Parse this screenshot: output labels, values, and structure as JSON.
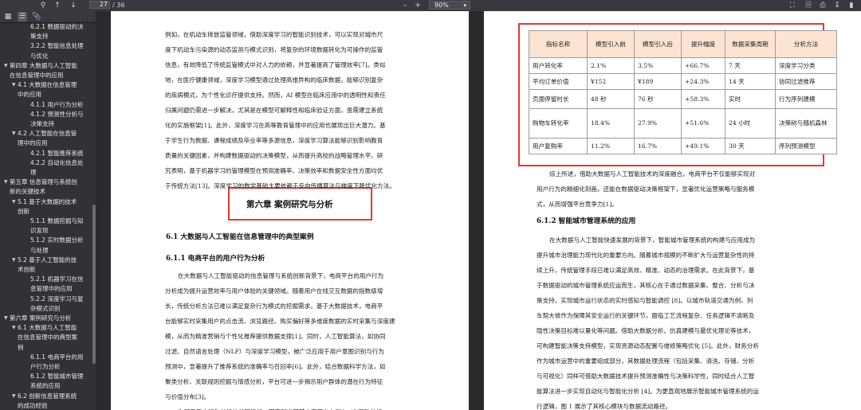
{
  "toolbar": {
    "page_current": "27",
    "page_total": "/ 36",
    "zoom": "90%"
  },
  "sidebar": {
    "items": [
      {
        "label": "6.2.1 数据驱动的决",
        "indent": 3,
        "twisty": ""
      },
      {
        "label": "策支持",
        "indent": 3,
        "twisty": ""
      },
      {
        "label": "3.2.2 智能信息处理",
        "indent": 3,
        "twisty": ""
      },
      {
        "label": "与优化",
        "indent": 3,
        "twisty": ""
      },
      {
        "label": "第四章 大数据与人工智能",
        "indent": 1,
        "twisty": "▼"
      },
      {
        "label": "在信息管理中的应用",
        "indent": 1,
        "twisty": ""
      },
      {
        "label": "4.1 大数据在信息管理",
        "indent": 2,
        "twisty": "▼"
      },
      {
        "label": "中的应用",
        "indent": 2,
        "twisty": ""
      },
      {
        "label": "4.1.1 用户行为分析",
        "indent": 3,
        "twisty": ""
      },
      {
        "label": "4.1.2 预测性分析与",
        "indent": 3,
        "twisty": ""
      },
      {
        "label": "决策支持",
        "indent": 3,
        "twisty": ""
      },
      {
        "label": "4.2 人工智能在信息管",
        "indent": 2,
        "twisty": "▼"
      },
      {
        "label": "理中的应用",
        "indent": 2,
        "twisty": ""
      },
      {
        "label": "4.2.1 智能推荐系统",
        "indent": 3,
        "twisty": ""
      },
      {
        "label": "4.2.2 自动化信息处",
        "indent": 3,
        "twisty": ""
      },
      {
        "label": "理",
        "indent": 3,
        "twisty": ""
      },
      {
        "label": "第五章 信息管理与系统创",
        "indent": 1,
        "twisty": "▼"
      },
      {
        "label": "新的关键技术",
        "indent": 1,
        "twisty": ""
      },
      {
        "label": "5.1 基于大数据的技术",
        "indent": 2,
        "twisty": "▼"
      },
      {
        "label": "创新",
        "indent": 2,
        "twisty": ""
      },
      {
        "label": "5.1.1 数据挖掘与知",
        "indent": 3,
        "twisty": ""
      },
      {
        "label": "识发现",
        "indent": 3,
        "twisty": ""
      },
      {
        "label": "5.1.2 实时数据分析",
        "indent": 3,
        "twisty": ""
      },
      {
        "label": "与处理",
        "indent": 3,
        "twisty": ""
      },
      {
        "label": "5.2 基于人工智能的技",
        "indent": 2,
        "twisty": "▼"
      },
      {
        "label": "术创新",
        "indent": 2,
        "twisty": ""
      },
      {
        "label": "5.2.1 机器学习在信",
        "indent": 3,
        "twisty": ""
      },
      {
        "label": "息管理中的应用",
        "indent": 3,
        "twisty": ""
      },
      {
        "label": "5.2.2 深度学习与复",
        "indent": 3,
        "twisty": ""
      },
      {
        "label": "杂模式识别",
        "indent": 3,
        "twisty": ""
      },
      {
        "label": "第六章 案例研究与分析",
        "indent": 1,
        "twisty": "▼"
      },
      {
        "label": "6.1 大数据与人工智能",
        "indent": 2,
        "twisty": "▼"
      },
      {
        "label": "在信息管理中的典型案",
        "indent": 2,
        "twisty": ""
      },
      {
        "label": "例",
        "indent": 2,
        "twisty": ""
      },
      {
        "label": "6.1.1 电商平台的用",
        "indent": 3,
        "twisty": ""
      },
      {
        "label": "户行为分析",
        "indent": 3,
        "twisty": ""
      },
      {
        "label": "6.1.2 智能城市管理",
        "indent": 3,
        "twisty": ""
      },
      {
        "label": "系统的应用",
        "indent": 3,
        "twisty": ""
      },
      {
        "label": "6.2 创新信息管理系统",
        "indent": 2,
        "twisty": "▼"
      },
      {
        "label": "的成功经验",
        "indent": 2,
        "twisty": ""
      }
    ]
  },
  "left_page": {
    "top_lines": [
      "例如，在机动车排放监管领域，借助深度学习的智能识别技术，可以实现对城市尺",
      "度下机动车污染源的动态监测与模式识别，将复杂的环境数据转化为可操作的监管",
      "信息，有效降低了传统监管模式中对人力的依赖，并显著提高了管理效率[7]。类似",
      "地，在医疗健康领域，深度学习模型通过处理高维异构的临床数据，能够识别复杂",
      "的疾病模式，为个性化诊疗提供支持。然而，AI 模型在临床应用中的透明性和责任",
      "归属问题仍需进一步解决，尤其是在模型可解释性和临床验证方面，亟需建立系统",
      "化的实施框架[1]。此外，深度学习在高等教育管理中的应用也展现出巨大潜力。基",
      "于学生行为数据、课程成绩及毕业率等多源信息，深度学习算法能够识别影响教育",
      "质量的关键因素，并构建数据驱动的决策模型，从而提升高校的战略管理水平。研",
      "究表明，基于机器学习的管理模型在预测准确率、决策效率和数据安全性方面均优",
      "于传统方法[13]。深度学习的数学基础主要依赖于反向传播算法与梯度下降优化方法。"
    ],
    "chapter_title": "第六章  案例研究与分析",
    "section_6_1": "6.1  大数据与人工智能在信息管理中的典型案例",
    "section_6_1_1": "6.1.1  电商平台的用户行为分析",
    "bottom_lines": [
      "在大数据与人工智能驱动的信息管理与系统创新背景下，电商平台的用户行为",
      "分析成为提升运营效率与用户体验的关键领域。随着用户在线交互数据的指数级增",
      "长，传统分析方法已难以满足复杂行为模式的挖掘需求。基于大数据技术，电商平",
      "台能够实时采集用户的点击流、浏览路径、购买偏好等多维度数据的实时采集与深度建",
      "模，从而为精准营销与个性化推荐提供数据支撑[1]。同时，人工智能算法，如协同",
      "过滤、自然语言处理（NLP）与深度学习模型，被广泛应用于用户意图识别与行为",
      "预测中，显著提升了推荐系统的准确率与召回率[6]。此外，结合数据科学方法，如",
      "聚类分析、关联规则挖掘与情感分析，平台可进一步揭示用户群体的潜在行为特征",
      "与价值分布[3]。",
      "为展示用户行为分析的关键指标，下表列出了某电商平台在引入 AI 驱动分析"
    ]
  },
  "right_page": {
    "table": {
      "headers": [
        "指标名称",
        "模型引入前",
        "模型引入后",
        "提升幅度",
        "数据采集周期",
        "分析方法"
      ],
      "rows": [
        [
          "用户转化率",
          "2.1%",
          "3.5%",
          "+66.7%",
          "7 天",
          "深度学习分类"
        ],
        [
          "平均订单价值",
          "¥152",
          "¥189",
          "+24.3%",
          "14 天",
          "协同过滤推荐"
        ],
        [
          "页面停留时长",
          "48 秒",
          "76 秒",
          "+58.3%",
          "实时",
          "行为序列建模"
        ],
        [
          "购物车转化率",
          "18.4%",
          "27.9%",
          "+51.6%",
          "24 小时",
          "决策树与随机森林"
        ],
        [
          "用户复购率",
          "11.2%",
          "16.7%",
          "+49.1%",
          "30 天",
          "序列预测模型"
        ]
      ]
    },
    "after_table_lines": [
      "综上所述，借助大数据与人工智能技术的深度融合，电商平台不仅能够实现对",
      "用户行为的精细化刻画，还能在数据驱动决策框架下，显著优化运营策略与服务模",
      "式，从而增强平台竞争力[1]。"
    ],
    "section_6_1_2": "6.1.2  智能城市管理系统的应用",
    "bottom_lines": [
      "在大数据与人工智能快速发展的背景下，智能城市管理系统的构建与应用成为",
      "提升城市治理能力现代化的重要方向。随着城市规模的不断扩大与运营复杂性的持",
      "续上升，传统管理手段已难以满足高效、精准、动态的治理需求。在此背景下，基",
      "于数据驱动的城市管理系统应运而生，其核心在于通过数据采集、整合、分析与决",
      "策支持，实现城市运行状态的实时感知与智能调控 [8]。以城市轨道交通为例，列",
      "车契大修作为保障其安全运行的关键环节，面临工艺流程复杂、任务逻辑不清晰及",
      "隐性决策目标难以量化等问题。借助大数据分析、仿真建模与最优化理论等技术，",
      "可构建智能决策支持模型，实现资源动态配置与维修策略优化 [5]。此外，财务分析",
      "作为城市运营中的重要组成部分，其数据处理流程（包括采集、清洗、存储、分析",
      "与可视化）同样可借助大数据技术提升预测准确性与决策科学性，同时结合人工智",
      "能算法进一步实现自动化与智能化分析 [4]。为更直观地展示智能城市管理系统的运",
      "行逻辑，图 1 展示了其核心模块与数据流动路径。"
    ]
  }
}
